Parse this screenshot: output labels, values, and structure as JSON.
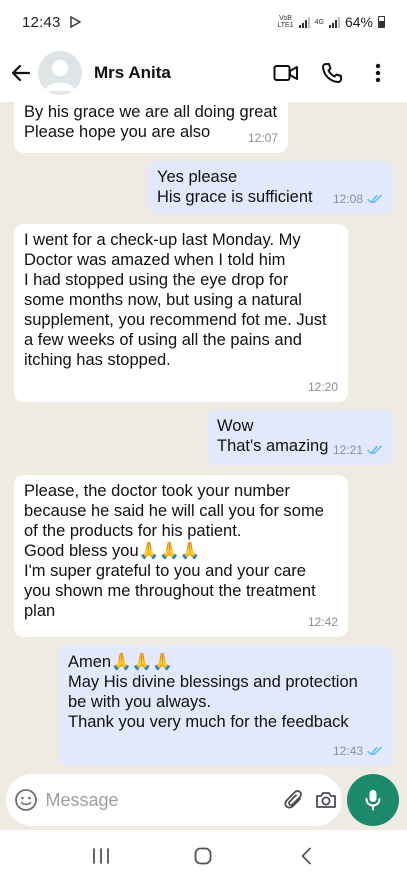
{
  "status_bar": {
    "time": "12:43",
    "network_top": "VoB",
    "network_bottom": "LTE1",
    "network_type": "4G",
    "battery": "64%"
  },
  "header": {
    "contact_name": "Mrs Anita"
  },
  "messages": [
    {
      "direction": "in",
      "text": "By his grace we are all doing great\nPlease hope you are also",
      "time": "12:07"
    },
    {
      "direction": "out",
      "text": "Yes please\nHis grace is sufficient",
      "time": "12:08"
    },
    {
      "direction": "in",
      "text": "I went for a check-up last Monday. My\nDoctor was amazed when I told him\nI had stopped using the eye drop for\nsome months now, but using a natural\nsupplement, you recommend fot me. Just\na few weeks of using all the pains and\nitching has stopped.",
      "time": "12:20"
    },
    {
      "direction": "out",
      "text": "Wow\nThat's amazing",
      "time": "12:21"
    },
    {
      "direction": "in",
      "text": "Please, the doctor took your number\nbecause he said he will call you for some\nof the products for his patient.\nGood bless you🙏🙏🙏\nI'm super grateful to you and your care\nyou shown me throughout the treatment\nplan",
      "time": "12:42"
    },
    {
      "direction": "out",
      "text": "Amen🙏🙏🙏\nMay His divine blessings and protection\nbe with you always.\nThank you very much for the feedback",
      "time": "12:43"
    }
  ],
  "composer": {
    "placeholder": "Message"
  },
  "colors": {
    "chat_bg": "#efeae2",
    "incoming_bubble": "#ffffff",
    "outgoing_bubble": "#e3e9fc",
    "read_ticks": "#53bdeb",
    "mic_button": "#1b8a6b"
  }
}
